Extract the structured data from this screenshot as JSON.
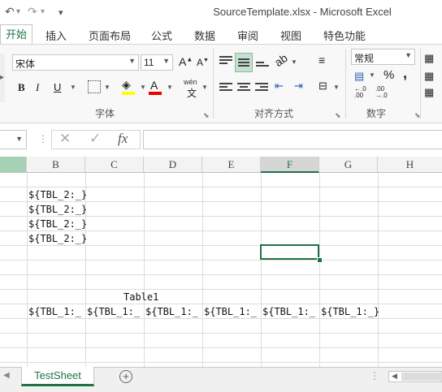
{
  "window": {
    "title": "SourceTemplate.xlsx - Microsoft Excel"
  },
  "qat": {
    "undo_icon": "undo-icon",
    "redo_icon": "redo-icon",
    "customize_icon": "customize-icon"
  },
  "tabs": [
    {
      "label": "开始",
      "active": true
    },
    {
      "label": "插入"
    },
    {
      "label": "页面布局"
    },
    {
      "label": "公式"
    },
    {
      "label": "数据"
    },
    {
      "label": "审阅"
    },
    {
      "label": "视图"
    },
    {
      "label": "特色功能"
    }
  ],
  "ribbon": {
    "font_group": {
      "font_name": "宋体",
      "font_size": "11",
      "grow_font": "A",
      "shrink_font": "A",
      "bold": "B",
      "italic": "I",
      "underline": "U",
      "font_color_glyph": "A",
      "phonetic": "wén",
      "label": "字体"
    },
    "alignment_group": {
      "label": "对齐方式"
    },
    "number_group": {
      "format": "常规",
      "percent": "%",
      "comma": ",",
      "inc_decimal": ".00",
      "label": "数字"
    }
  },
  "formula_bar": {
    "cancel_glyph": "✕",
    "enter_glyph": "✓",
    "fx_glyph": "fx",
    "value": ""
  },
  "columns": [
    "B",
    "C",
    "D",
    "E",
    "F",
    "G",
    "H"
  ],
  "selected_column": "F",
  "cells": {
    "b2": "${TBL_2:_}",
    "b3": "${TBL_2:_}",
    "b4": "${TBL_2:_}",
    "b5": "${TBL_2:_}",
    "table_title": "Table1",
    "row_tbl1": [
      "${TBL_1:_",
      "${TBL_1:_",
      "${TBL_1:_",
      "${TBL_1:_",
      "${TBL_1:_",
      "${TBL_1:_}"
    ]
  },
  "sheet": {
    "tab_label": "TestSheet",
    "add_icon": "plus-circle-icon"
  },
  "colors": {
    "accent": "#217346"
  }
}
